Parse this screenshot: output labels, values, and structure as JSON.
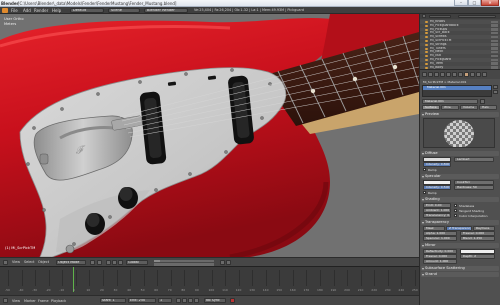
{
  "window": {
    "app": "Blender",
    "path": "[C:\\Users\\Blender\\_data\\Models\\Fender\\FenderMustang\\Fender_Mustang.blend]",
    "min": "–",
    "max": "□",
    "close": "✕"
  },
  "info_header": {
    "menus": [
      "File",
      "Add",
      "Render",
      "Help"
    ],
    "screen": "Default",
    "scene": "Scene",
    "engine": "Blender Render",
    "stats": "Ve:25,404 | Fa:26,204 | Ob:1-32 | La:1 | Mem:49.93M | Pickguard"
  },
  "viewport": {
    "view_label": "User Ortho",
    "units_label": "Meters",
    "active_object": "(1) Mi_ScrPickTM"
  },
  "view3d_header": {
    "menus": [
      "View",
      "Select",
      "Object"
    ],
    "mode": "Object Mode",
    "pivot": "Global"
  },
  "timeline": {
    "ticks": [
      "-50",
      "-40",
      "-30",
      "-20",
      "-10",
      "0",
      "10",
      "20",
      "30",
      "40",
      "50",
      "60",
      "70",
      "80",
      "90",
      "100",
      "110",
      "120",
      "130",
      "140",
      "150",
      "160",
      "170",
      "180",
      "190",
      "200",
      "210",
      "220",
      "230",
      "240",
      "250"
    ],
    "footer_menus": [
      "View",
      "Marker",
      "Frame",
      "Playback"
    ],
    "start": "Start: 1",
    "end": "End: 250",
    "current": "1",
    "sync": "No Sync"
  },
  "outliner": {
    "rows": [
      "Mi_Knobs",
      "Mi_PickguardBack",
      "Mi_Pickups",
      "Mi_Scr_Back",
      "Mi_Screws",
      "Mi_ScrPickTM",
      "Mi_Strings",
      "Mi_Tuners",
      "Mi_Neck",
      "Mi_Nut",
      "Mi_Pickguard",
      "Mi_Trem",
      "Mi_Body"
    ]
  },
  "properties": {
    "breadcrumb": "Mi_ScrPickTM > Material.001",
    "material_slot": "Material.001",
    "material_name": "Material.001",
    "tabs": [
      "Surface",
      "Wire",
      "Volume",
      "Halo"
    ],
    "panels": {
      "preview": "Preview",
      "diffuse": "Diffuse",
      "specular": "Specular",
      "shading": "Shading",
      "transparency": "Transparency",
      "mirror": "Mirror",
      "sss": "Subsurface Scattering",
      "strand": "Strand"
    },
    "diffuse": {
      "shader": "Lambert",
      "intensity": "Intensity: 0.800",
      "ramp": "Ramp"
    },
    "specular": {
      "shader": "CookTorr",
      "intensity": "Intensity: 0.500",
      "hardness": "Hardness: 50",
      "ramp": "Ramp"
    },
    "shading": {
      "emit": "Emit: 0.00",
      "ambient": "Ambient: 1.000",
      "translucency": "Translucency: 0.000",
      "shadeless": "Shadeless",
      "tangent": "Tangent Shading",
      "cubic": "Cubic Interpolation"
    },
    "transparency": {
      "modes": [
        "Mask",
        "Z Transparency",
        "Raytrace"
      ],
      "alpha": "Alpha: 1.000",
      "fresnel": "Fresnel: 0.000",
      "specular": "Specular: 1.000",
      "blend": "Blend: 1.250"
    },
    "mirror": {
      "reflect": "Reflectivity: 0.000",
      "fresnel": "Fresnel: 0.000",
      "depth": "Depth: 2",
      "gloss": "Amount: 1.000"
    }
  },
  "colors": {
    "body_red": "#c8101c",
    "body_highlight": "#ff3a3a",
    "pickguard": "#cfcfcf",
    "fretboard": "#3d1a12",
    "chrome": "#b9b9b9",
    "blender_bg": "#707070"
  }
}
